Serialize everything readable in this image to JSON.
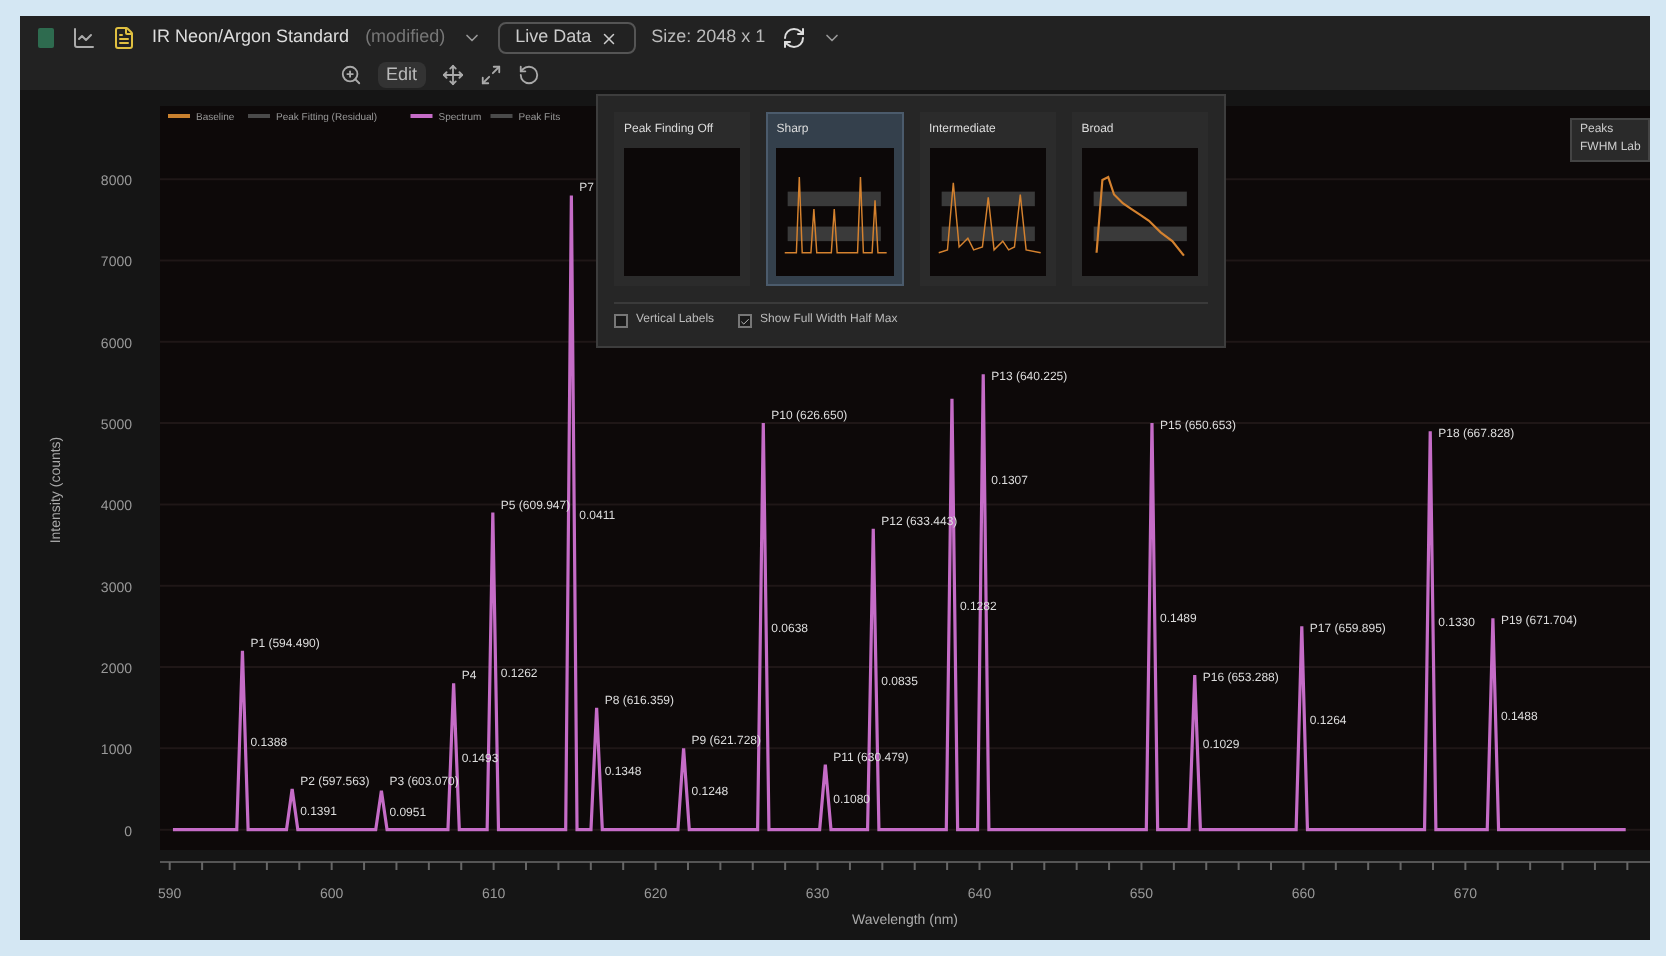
{
  "toolbar": {
    "title": "IR Neon/Argon Standard",
    "subtitle": "(modified)",
    "source": "Live Data",
    "size": "Size: 2048 x 1",
    "zoom_mode": "Edit"
  },
  "legend": {
    "before": [
      {
        "label": "Baseline",
        "color": "#c9812e"
      },
      {
        "label": "Peak Fitting (Residual)",
        "color": "#4a4a4a"
      }
    ],
    "after": [
      {
        "label": "Peak Fits",
        "color": "#4a4a4a"
      }
    ]
  },
  "peak_menu": {
    "options": [
      {
        "label": "Peak Finding Off",
        "kind": "off",
        "selected": false
      },
      {
        "label": "Sharp",
        "kind": "sharp",
        "selected": true
      },
      {
        "label": "Intermediate",
        "kind": "intermediate",
        "selected": false
      },
      {
        "label": "Broad",
        "kind": "broad",
        "selected": false
      }
    ],
    "toggles": [
      {
        "label": "Vertical Labels",
        "checked": false
      },
      {
        "label": "Show Full Width Half Max",
        "checked": true
      }
    ]
  },
  "overlay_legend": [
    {
      "label": "Peaks"
    },
    {
      "label": "FWHM Lab"
    }
  ],
  "chart": {
    "chart_data": {
      "type": "line",
      "xlabel": "Wavelength (nm)",
      "ylabel": "Intensity (counts)",
      "grid": true,
      "x": [
        590.2,
        594.14,
        594.49,
        594.84,
        597.21,
        597.56,
        597.91,
        602.72,
        603.07,
        603.42,
        607.18,
        607.53,
        607.88,
        609.6,
        609.95,
        610.3,
        614.45,
        614.8,
        615.15,
        616.01,
        616.36,
        616.71,
        621.38,
        621.73,
        622.08,
        626.3,
        626.65,
        627.0,
        630.13,
        630.48,
        630.83,
        633.09,
        633.44,
        633.79,
        637.95,
        638.3,
        638.65,
        639.88,
        640.23,
        640.58,
        650.3,
        650.65,
        651.0,
        652.94,
        653.29,
        653.64,
        659.55,
        659.9,
        660.25,
        667.48,
        667.83,
        668.18,
        671.35,
        671.7,
        672.05,
        679.9
      ],
      "series": [
        {
          "name": "Spectrum",
          "color": "#c56cc7",
          "values": [
            0,
            0,
            2200,
            0,
            0,
            500,
            0,
            0,
            480,
            0,
            0,
            1800,
            0,
            0,
            3900,
            0,
            0,
            7800,
            0,
            0,
            1500,
            0,
            0,
            1000,
            0,
            0,
            5000,
            0,
            0,
            800,
            0,
            0,
            3700,
            0,
            0,
            5300,
            0,
            0,
            5600,
            0,
            0,
            5000,
            0,
            0,
            1900,
            0,
            0,
            2500,
            0,
            0,
            4900,
            0,
            0,
            2600,
            0,
            0
          ]
        }
      ],
      "xlim": [
        589.4,
        681.4
      ],
      "ylim": [
        -250,
        8900
      ],
      "xticks": [
        590,
        600,
        610,
        620,
        630,
        640,
        650,
        660,
        670
      ],
      "yticks": [
        0,
        1000,
        2000,
        3000,
        4000,
        5000,
        6000,
        7000,
        8000
      ],
      "annotations": [
        {
          "x": 594.49,
          "y": 2200,
          "text": "P1 (594.490)"
        },
        {
          "x": 594.49,
          "y": 1100,
          "text": "0.1388"
        },
        {
          "x": 597.56,
          "y": 500,
          "text": "P2 (597.563)"
        },
        {
          "x": 597.56,
          "y": 250,
          "text": "0.1391"
        },
        {
          "x": 603.07,
          "y": 500,
          "text": "P3 (603.070)"
        },
        {
          "x": 603.07,
          "y": 240,
          "text": "0.0951"
        },
        {
          "x": 607.53,
          "y": 1800,
          "text": "P4"
        },
        {
          "x": 607.53,
          "y": 900,
          "text": "0.1493"
        },
        {
          "x": 609.95,
          "y": 3900,
          "text": "P5 (609.947)"
        },
        {
          "x": 609.95,
          "y": 1950,
          "text": "0.1262"
        },
        {
          "x": 614.8,
          "y": 7800,
          "text": "P7"
        },
        {
          "x": 614.8,
          "y": 3900,
          "text": "0.0411"
        },
        {
          "x": 616.36,
          "y": 1500,
          "text": "P8 (616.359)"
        },
        {
          "x": 616.36,
          "y": 750,
          "text": "0.1348"
        },
        {
          "x": 621.73,
          "y": 1000,
          "text": "P9 (621.728)"
        },
        {
          "x": 621.73,
          "y": 500,
          "text": "0.1248"
        },
        {
          "x": 626.65,
          "y": 5000,
          "text": "P10 (626.650)"
        },
        {
          "x": 626.65,
          "y": 2500,
          "text": "0.0638"
        },
        {
          "x": 630.48,
          "y": 800,
          "text": "P11 (630.479)"
        },
        {
          "x": 630.48,
          "y": 400,
          "text": "0.1080"
        },
        {
          "x": 633.44,
          "y": 3700,
          "text": "P12 (633.443)"
        },
        {
          "x": 633.44,
          "y": 1850,
          "text": "0.0835"
        },
        {
          "x": 638.3,
          "y": 2650,
          "text": "0.1282"
        },
        {
          "x": 640.23,
          "y": 5600,
          "text": "P13 (640.225)"
        },
        {
          "x": 640.23,
          "y": 4200,
          "text": "0.1307"
        },
        {
          "x": 650.65,
          "y": 5000,
          "text": "P15 (650.653)"
        },
        {
          "x": 650.65,
          "y": 2500,
          "text": "0.1489"
        },
        {
          "x": 653.29,
          "y": 1900,
          "text": "P16 (653.288)"
        },
        {
          "x": 653.29,
          "y": 950,
          "text": "0.1029"
        },
        {
          "x": 659.9,
          "y": 2500,
          "text": "P17 (659.895)"
        },
        {
          "x": 659.9,
          "y": 1250,
          "text": "0.1264"
        },
        {
          "x": 667.83,
          "y": 4900,
          "text": "P18 (667.828)"
        },
        {
          "x": 667.83,
          "y": 2450,
          "text": "0.1330"
        },
        {
          "x": 671.7,
          "y": 2600,
          "text": "P19 (671.704)"
        },
        {
          "x": 671.7,
          "y": 1300,
          "text": "0.1488"
        }
      ]
    }
  }
}
